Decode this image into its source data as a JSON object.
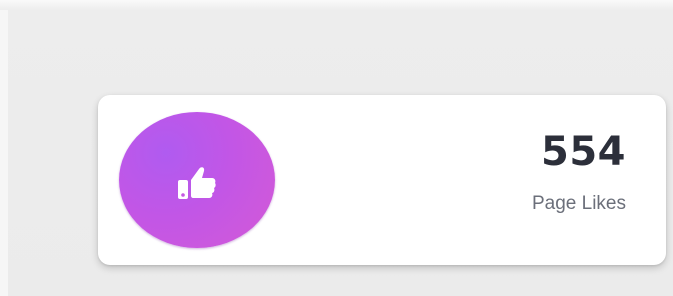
{
  "widget": {
    "value": "554",
    "label": "Page Likes",
    "icon": "thumbs-up-icon",
    "accent_gradient": [
      "#b05bf0",
      "#d45ad6"
    ]
  }
}
